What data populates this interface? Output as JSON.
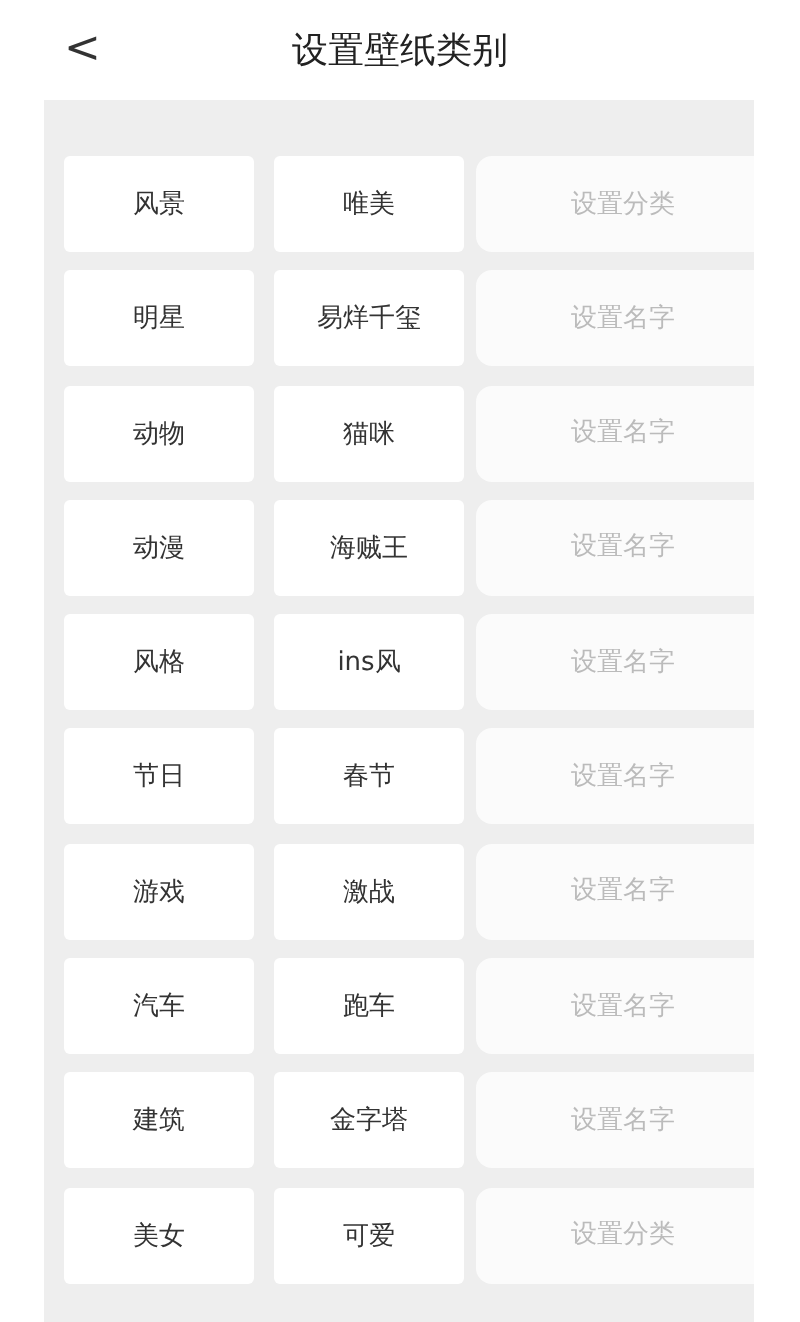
{
  "header": {
    "back": "<",
    "title": "设置壁纸类别"
  },
  "rows": [
    {
      "category": "风景",
      "name": "唯美",
      "placeholder": "设置分类"
    },
    {
      "category": "明星",
      "name": "易烊千玺",
      "placeholder": "设置名字"
    },
    {
      "category": "动物",
      "name": "猫咪",
      "placeholder": "设置名字"
    },
    {
      "category": "动漫",
      "name": "海贼王",
      "placeholder": "设置名字"
    },
    {
      "category": "风格",
      "name": "ins风",
      "placeholder": "设置名字"
    },
    {
      "category": "节日",
      "name": "春节",
      "placeholder": "设置名字"
    },
    {
      "category": "游戏",
      "name": "激战",
      "placeholder": "设置名字"
    },
    {
      "category": "汽车",
      "name": "跑车",
      "placeholder": "设置名字"
    },
    {
      "category": "建筑",
      "name": "金字塔",
      "placeholder": "设置名字"
    },
    {
      "category": "美女",
      "name": "可爱",
      "placeholder": "设置分类"
    }
  ]
}
